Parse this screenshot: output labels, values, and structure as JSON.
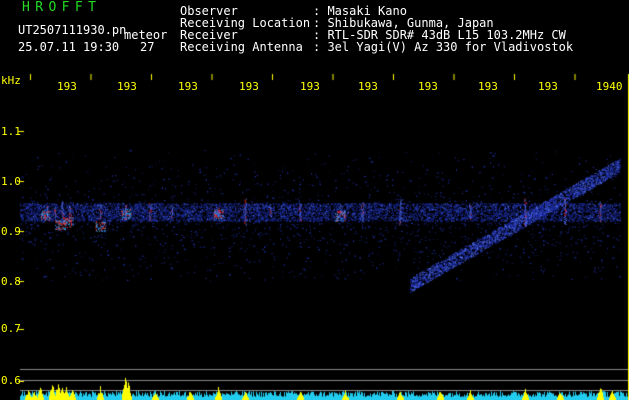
{
  "header": {
    "title": "HROFFT",
    "filename": "UT2507111930.pn",
    "meteor_label": "meteor",
    "datetime": "25.07.11 19:30",
    "count": "27"
  },
  "info": [
    {
      "key": "Observer",
      "value": ": Masaki Kano"
    },
    {
      "key": "Receiving Location",
      "value": ": Shibukawa, Gunma, Japan"
    },
    {
      "key": "Receiver",
      "value": ": RTL-SDR SDR# 43dB L15 103.2MHz CW"
    },
    {
      "key": "Receiving Antenna",
      "value": ": 3el Yagi(V) Az 330 for Vladivostok"
    }
  ],
  "axis": {
    "unit": "kHz",
    "y_ticks": [
      "1.1",
      "1.0",
      "0.9",
      "0.8",
      "0.7",
      "0.6"
    ],
    "x_ticks": [
      "193",
      "193",
      "193",
      "193",
      "193",
      "193",
      "193",
      "193",
      "193",
      "1940"
    ]
  },
  "colors": {
    "background": "#000000",
    "text": "#ffffff",
    "title": "#22dd22",
    "axis": "#ffff00",
    "signal": "#2244ff",
    "hot": "#ff3030",
    "power": "#ffff00",
    "noise": "#22ccee"
  }
}
